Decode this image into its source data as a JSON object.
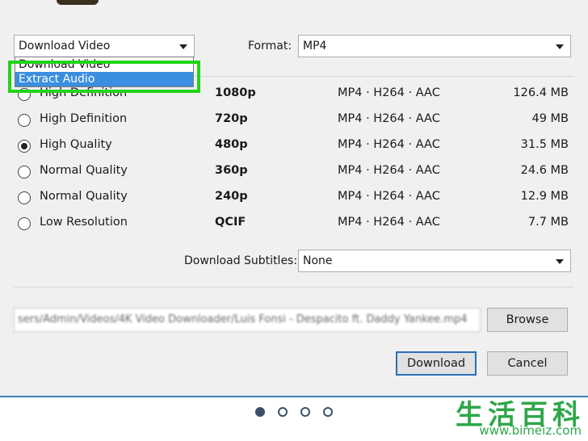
{
  "download_type": {
    "selected": "Download Video",
    "options": [
      "Download Video",
      "Extract Audio"
    ],
    "highlighted": "Extract Audio"
  },
  "format": {
    "label": "Format:",
    "value": "MP4"
  },
  "qualities": [
    {
      "label": "High Definition",
      "resolution": "1080p",
      "format": "MP4 · H264 · AAC",
      "size": "126.4 MB",
      "selected": false
    },
    {
      "label": "High Definition",
      "resolution": "720p",
      "format": "MP4 · H264 · AAC",
      "size": "49 MB",
      "selected": false
    },
    {
      "label": "High Quality",
      "resolution": "480p",
      "format": "MP4 · H264 · AAC",
      "size": "31.5 MB",
      "selected": true
    },
    {
      "label": "Normal Quality",
      "resolution": "360p",
      "format": "MP4 · H264 · AAC",
      "size": "24.6 MB",
      "selected": false
    },
    {
      "label": "Normal Quality",
      "resolution": "240p",
      "format": "MP4 · H264 · AAC",
      "size": "12.9 MB",
      "selected": false
    },
    {
      "label": "Low Resolution",
      "resolution": "QCIF",
      "format": "MP4 · H264 · AAC",
      "size": "7.7 MB",
      "selected": false
    }
  ],
  "subtitles": {
    "label": "Download Subtitles:",
    "value": "None"
  },
  "save_path": "sers/Admin/Videos/4K Video Downloader/Luis Fonsi - Despacito ft. Daddy Yankee.mp4",
  "buttons": {
    "browse": "Browse",
    "download": "Download",
    "cancel": "Cancel"
  },
  "pager": {
    "count": 4,
    "active": 1
  },
  "watermark": {
    "chinese": "生活百科",
    "url": "www.bimeiz.com"
  },
  "colors": {
    "highlight_box": "#21d418",
    "selection": "#3b8fe0",
    "primary_border": "#2b6fb5"
  }
}
